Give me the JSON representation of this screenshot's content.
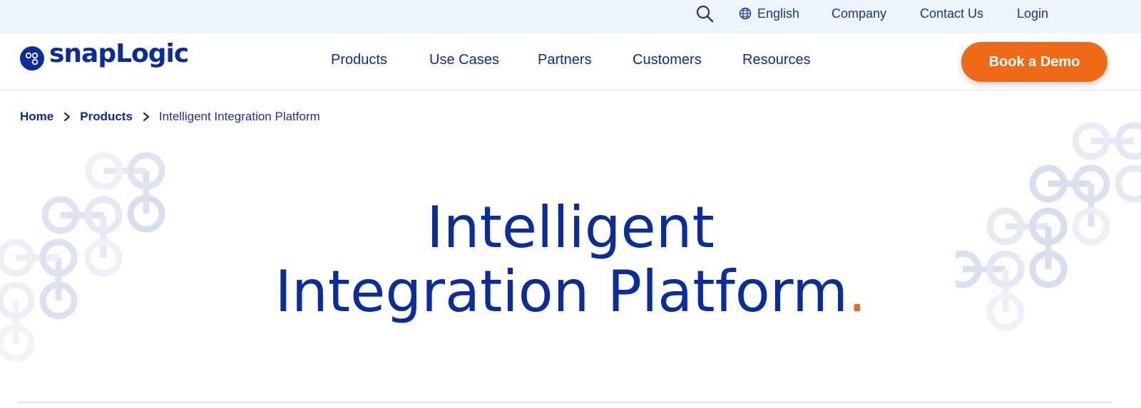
{
  "utility_bar": {
    "language": "English",
    "links": [
      "Company",
      "Contact Us",
      "Login"
    ]
  },
  "header": {
    "logo_text": "snapLogic",
    "nav": [
      "Products",
      "Use Cases",
      "Partners",
      "Customers",
      "Resources"
    ],
    "cta_label": "Book a Demo"
  },
  "breadcrumb": {
    "items": [
      "Home",
      "Products"
    ],
    "current": "Intelligent Integration Platform"
  },
  "hero": {
    "title_line1": "Intelligent",
    "title_line2": "Integration Platform",
    "title_punct": "."
  },
  "colors": {
    "brand_blue": "#0a2c9c",
    "accent_orange": "#ee6a17",
    "utility_bg": "#eef4fb"
  },
  "icons": [
    "search-icon",
    "globe-icon",
    "chevron-right-icon",
    "snaplogic-logo-icon"
  ]
}
